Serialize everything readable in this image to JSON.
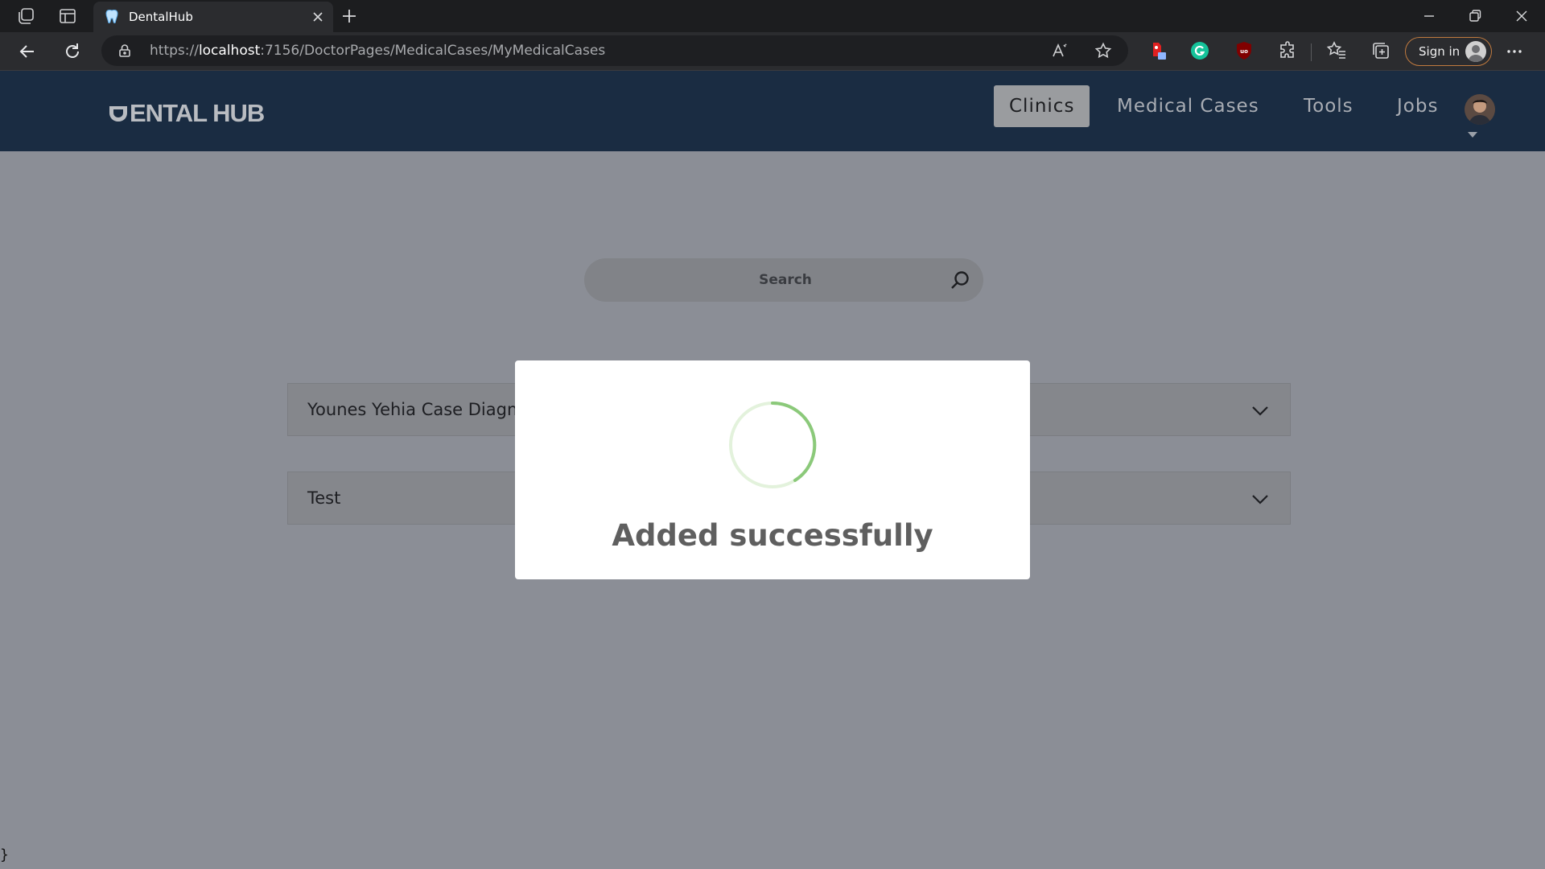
{
  "browser": {
    "tab_title": "DentalHub",
    "url_scheme": "https://",
    "url_host": "localhost",
    "url_path": ":7156/DoctorPages/MedicalCases/MyMedicalCases",
    "signin_label": "Sign in",
    "icons": [
      "workspaces-icon",
      "tab-actions-icon",
      "tooth-favicon-icon",
      "close-tab-icon",
      "new-tab-icon",
      "back-icon",
      "refresh-icon",
      "lock-icon",
      "read-aloud-icon",
      "favorite-star-icon",
      "extension-red-icon",
      "grammarly-icon",
      "ublock-icon",
      "extensions-icon",
      "favorites-icon",
      "collections-icon",
      "more-icon",
      "minimize-icon",
      "restore-icon",
      "close-window-icon"
    ]
  },
  "header": {
    "logo": "ENTAL HUB",
    "nav": [
      {
        "label": "Clinics",
        "active": true
      },
      {
        "label": "Medical Cases",
        "active": false
      },
      {
        "label": "Tools",
        "active": false
      },
      {
        "label": "Jobs",
        "active": false
      }
    ]
  },
  "search": {
    "placeholder": "Search"
  },
  "cases": [
    {
      "title": "Younes Yehia Case Diagno"
    },
    {
      "title": "Test"
    }
  ],
  "modal": {
    "message": "Added successfully"
  },
  "stray_text": "}",
  "colors": {
    "header_bg": "#1a2c42",
    "overlay_bg": "#8b8e96",
    "spinner_green": "#8bc97a",
    "spinner_track": "#e3f2dc",
    "active_nav_bg": "#9a9c9f"
  }
}
